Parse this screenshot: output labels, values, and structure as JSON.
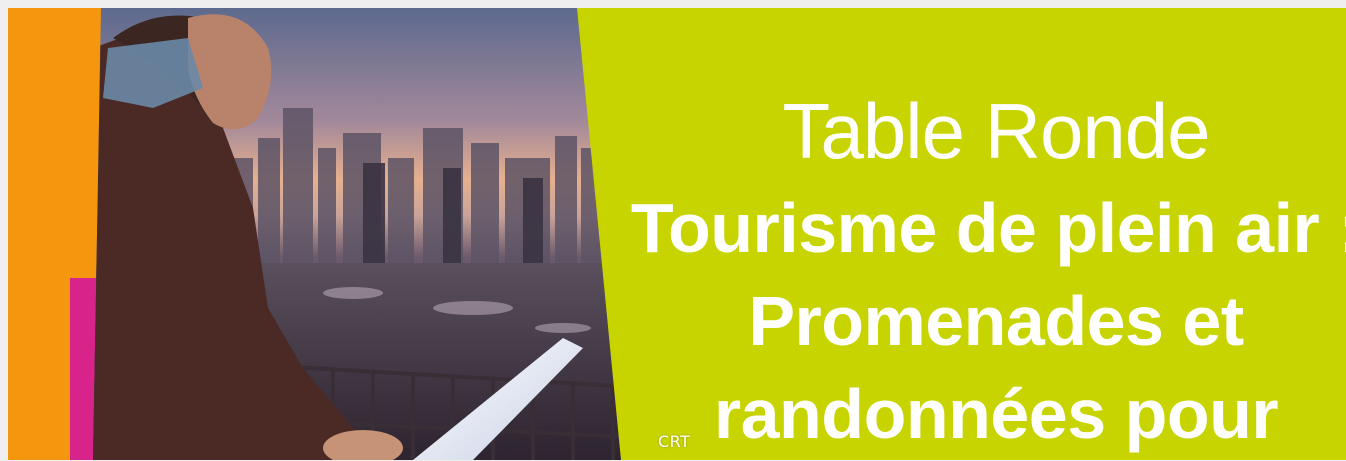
{
  "banner": {
    "kicker": "Table Ronde",
    "title": "Tourisme de plein air : Promenades et randonnées pour",
    "credit": "CRT",
    "colors": {
      "green": "#c8d400",
      "orange": "#f5960f",
      "magenta": "#d8248a",
      "text": "#ffffff"
    }
  }
}
